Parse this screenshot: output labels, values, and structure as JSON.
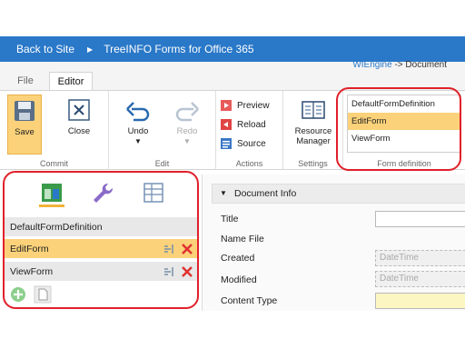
{
  "topbar": {
    "back_label": "Back to Site",
    "separator": "▶",
    "app_title": "TreeINFO Forms for Office 365"
  },
  "breadcrumb": {
    "engine": "WIEngine",
    "rest": " -> Document"
  },
  "tabs": [
    {
      "label": "File"
    },
    {
      "label": "Editor",
      "active": true
    }
  ],
  "ribbon": {
    "commit": {
      "save": "Save",
      "close": "Close",
      "label": "Commit"
    },
    "edit": {
      "undo": "Undo",
      "redo": "Redo",
      "label": "Edit"
    },
    "actions": {
      "preview": "Preview",
      "reload": "Reload",
      "source": "Source",
      "label": "Actions"
    },
    "settings": {
      "resource_manager": "Resource\nManager",
      "label": "Settings"
    },
    "form_definition": {
      "items": [
        "DefaultFormDefinition",
        "EditForm",
        "ViewForm"
      ],
      "selected": "EditForm",
      "label": "Form definition"
    }
  },
  "leftpane": {
    "icons": [
      "form-layout-icon",
      "wrench-icon",
      "table-icon"
    ],
    "rows": [
      {
        "label": "DefaultFormDefinition",
        "selected": false,
        "actions": false
      },
      {
        "label": "EditForm",
        "selected": true,
        "actions": true
      },
      {
        "label": "ViewForm",
        "selected": false,
        "actions": true
      }
    ]
  },
  "rightpane": {
    "section_title": "Document Info",
    "fields": [
      {
        "label": "Title",
        "value": "",
        "style": "normal"
      },
      {
        "label": "Name File",
        "value": "",
        "style": "none"
      },
      {
        "label": "Created",
        "placeholder": "DateTime",
        "style": "dashed"
      },
      {
        "label": "Modified",
        "placeholder": "DateTime",
        "style": "dashed"
      },
      {
        "label": "Content Type",
        "value": "",
        "style": "yellow"
      }
    ]
  },
  "colors": {
    "brand_blue": "#2a78c8",
    "selection": "#fbd27a",
    "highlight_ring": "#e0202a"
  }
}
